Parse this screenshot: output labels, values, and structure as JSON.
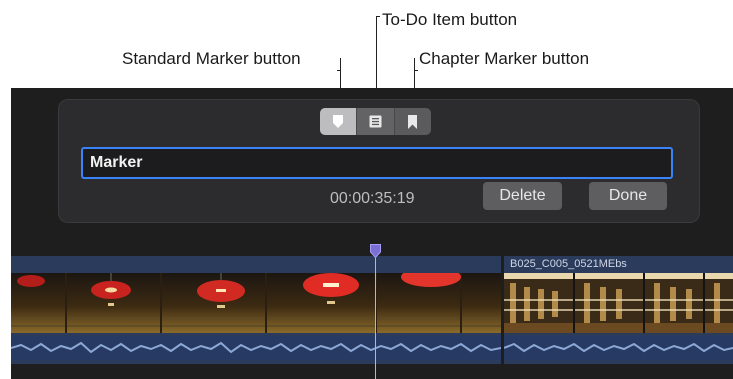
{
  "callouts": {
    "todo": "To-Do Item button",
    "standard": "Standard Marker button",
    "chapter": "Chapter Marker button"
  },
  "popover": {
    "marker_types": [
      {
        "icon": "standard-marker-icon",
        "selected": true
      },
      {
        "icon": "todo-item-icon",
        "selected": false
      },
      {
        "icon": "chapter-marker-icon",
        "selected": false
      }
    ],
    "name_value": "Marker",
    "timecode": "00:00:35:19",
    "delete_label": "Delete",
    "done_label": "Done"
  },
  "timeline": {
    "clip2_name": "B025_C005_0521MEbs",
    "marker_color": "#7b6fd6",
    "clip_color": "#2b3b5c"
  }
}
